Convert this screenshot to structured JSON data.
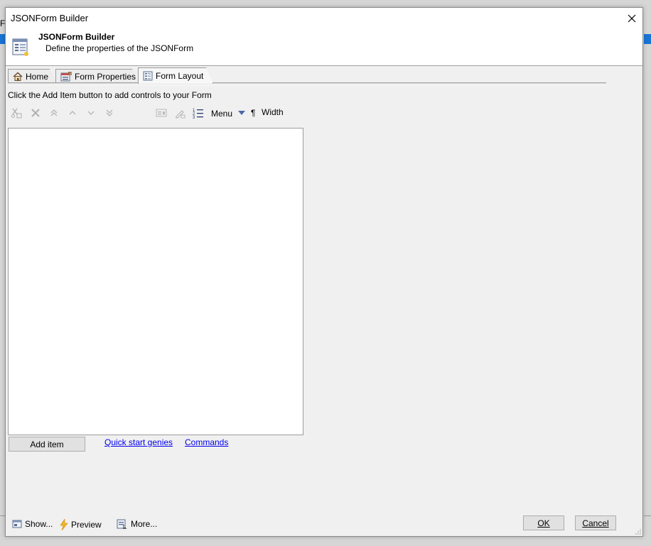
{
  "background": {
    "behind_letter": "Fi"
  },
  "window": {
    "title": "JSONForm Builder"
  },
  "header": {
    "title": "JSONForm Builder",
    "subtitle": "Define the properties of the JSONForm"
  },
  "tabs": [
    {
      "label": "Home",
      "icon": "home-icon"
    },
    {
      "label": "Form Properties",
      "icon": "form-properties-icon"
    },
    {
      "label": "Form Layout",
      "icon": "form-layout-icon",
      "active": true
    }
  ],
  "instruction": "Click the Add Item button to add controls to your Form",
  "toolbar": {
    "icons": [
      "cut-icon",
      "delete-icon",
      "move-top-icon",
      "move-up-icon",
      "move-down-icon",
      "move-bottom-icon",
      "properties-icon",
      "edit-icon",
      "numbered-list-icon"
    ],
    "menu_label": "Menu",
    "pilcrow": "¶",
    "width_label": "Width"
  },
  "actions": {
    "add_item": "Add item",
    "quick_start": "Quick start genies",
    "commands": "Commands"
  },
  "footer": {
    "show_label": "Show...",
    "preview_label": "Preview",
    "more_label": "More...",
    "ok_label": "OK",
    "cancel_label": "Cancel"
  },
  "colors": {
    "accent": "#1874d6",
    "dialog_bg": "#f0f0f0",
    "link": "#0000ee"
  }
}
